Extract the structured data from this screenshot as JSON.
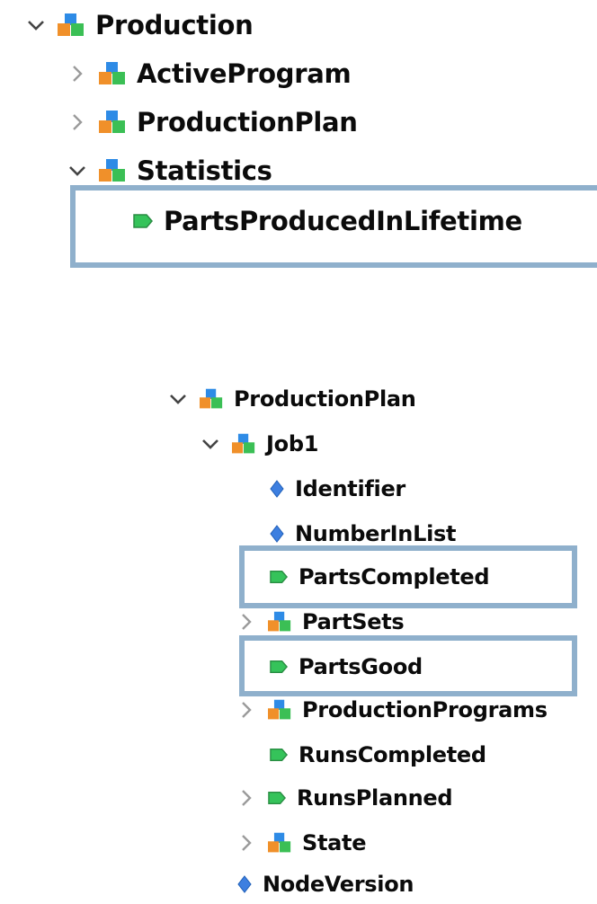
{
  "tree_top": {
    "root": {
      "label": "Production",
      "icon": "object-folder-icon",
      "expanded": true
    },
    "children": [
      {
        "label": "ActiveProgram",
        "icon": "object-folder-icon",
        "expanded": false
      },
      {
        "label": "ProductionPlan",
        "icon": "object-folder-icon",
        "expanded": false
      },
      {
        "label": "Statistics",
        "icon": "object-folder-icon",
        "expanded": true
      },
      {
        "label": "PartsProducedInLifetime",
        "icon": "variable-tag-icon",
        "highlighted": true
      }
    ]
  },
  "tree_bottom": {
    "root": {
      "label": "ProductionPlan",
      "icon": "object-folder-icon",
      "expanded": true
    },
    "job": {
      "label": "Job1",
      "icon": "object-folder-icon",
      "expanded": true
    },
    "items": [
      {
        "label": "Identifier",
        "icon": "property-diamond-icon"
      },
      {
        "label": "NumberInList",
        "icon": "property-diamond-icon"
      },
      {
        "label": "PartsCompleted",
        "icon": "variable-tag-icon",
        "highlighted": true
      },
      {
        "label": "PartSets",
        "icon": "object-folder-icon",
        "expandable": true
      },
      {
        "label": "PartsGood",
        "icon": "variable-tag-icon",
        "highlighted": true
      },
      {
        "label": "ProductionPrograms",
        "icon": "object-folder-icon",
        "expandable": true
      },
      {
        "label": "RunsCompleted",
        "icon": "variable-tag-icon"
      },
      {
        "label": "RunsPlanned",
        "icon": "variable-tag-icon",
        "expandable": true
      },
      {
        "label": "State",
        "icon": "object-folder-icon",
        "expandable": true
      }
    ],
    "trailing": {
      "label": "NodeVersion",
      "icon": "property-diamond-icon"
    }
  },
  "colors": {
    "highlight_border": "#8fb0cc",
    "tag_green": "#35c35a",
    "folder_orange": "#f0902a",
    "folder_blue": "#2e8be6",
    "folder_green": "#3bbf55",
    "diamond_blue": "#3d7fe0"
  }
}
